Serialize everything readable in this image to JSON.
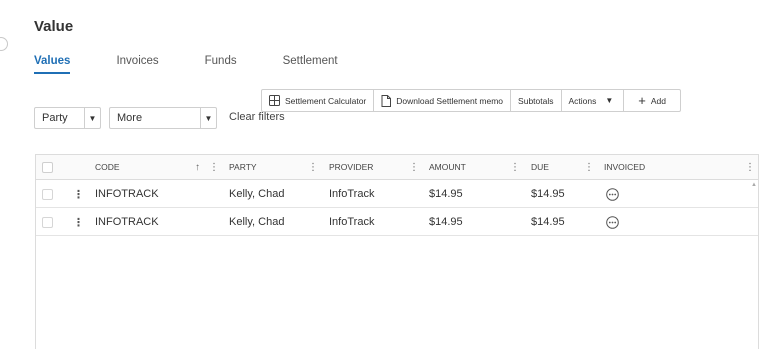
{
  "page": {
    "title": "Value"
  },
  "tabs": [
    {
      "label": "Values",
      "active": true
    },
    {
      "label": "Invoices",
      "active": false
    },
    {
      "label": "Funds",
      "active": false
    },
    {
      "label": "Settlement",
      "active": false
    }
  ],
  "toolbar": {
    "settlement_calculator": "Settlement Calculator",
    "download_memo": "Download Settlement memo",
    "subtotals": "Subtotals",
    "actions": "Actions",
    "add": "Add"
  },
  "filters": {
    "party": "Party",
    "more": "More",
    "clear": "Clear filters"
  },
  "table": {
    "columns": {
      "code": "CODE",
      "party": "PARTY",
      "provider": "PROVIDER",
      "amount": "AMOUNT",
      "due": "DUE",
      "invoiced": "INVOICED"
    },
    "rows": [
      {
        "code": "INFOTRACK",
        "party": "Kelly, Chad",
        "provider": "InfoTrack",
        "amount": "$14.95",
        "due": "$14.95",
        "invoiced_icon": "ellipsis-circle-icon"
      },
      {
        "code": "INFOTRACK",
        "party": "Kelly, Chad",
        "provider": "InfoTrack",
        "amount": "$14.95",
        "due": "$14.95",
        "invoiced_icon": "ellipsis-circle-icon"
      }
    ]
  },
  "colors": {
    "accent": "#1f6fb5",
    "border": "#dcdcdc"
  }
}
